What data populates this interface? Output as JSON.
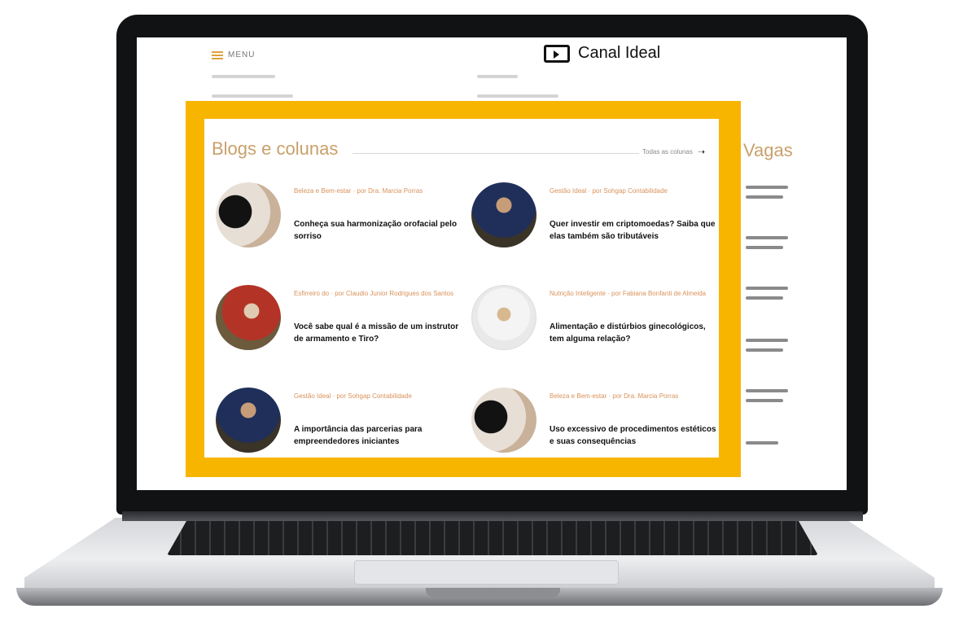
{
  "header": {
    "menu_label": "MENU",
    "logo_text": "Canal Ideal"
  },
  "sidebar": {
    "title": "Vagas"
  },
  "blogs": {
    "title": "Blogs e colunas",
    "all_link": "Todas as colunas"
  },
  "posts": [
    {
      "category": "Beleza e Bem-estar · por Dra. Marcia Porras",
      "headline": "Conheça sua harmonização orofacial pelo sorriso"
    },
    {
      "category": "Gestão Ideal · por Sohgap Contabilidade",
      "headline": "Quer investir em criptomoedas? Saiba que elas também são tributáveis"
    },
    {
      "category": "Esfirreiro do · por Claudio Junior Rodrigues dos Santos",
      "headline": "Você sabe qual é a missão de um instrutor de armamento e Tiro?"
    },
    {
      "category": "Nutrição Inteligente · por Fabiana Bonfanti de Almeida",
      "headline": "Alimentação e distúrbios ginecológicos, tem alguma relação?"
    },
    {
      "category": "Gestão Ideal · por Sohgap Contabilidade",
      "headline": "A importância das parcerias para empreendedores iniciantes"
    },
    {
      "category": "Beleza e Bem-estar · por Dra. Marcia Porras",
      "headline": "Uso excessivo de procedimentos estéticos e suas consequências"
    }
  ],
  "colors": {
    "accent_frame": "#f7b500",
    "title_color": "#c9a06b",
    "category_color": "#d9925b"
  }
}
